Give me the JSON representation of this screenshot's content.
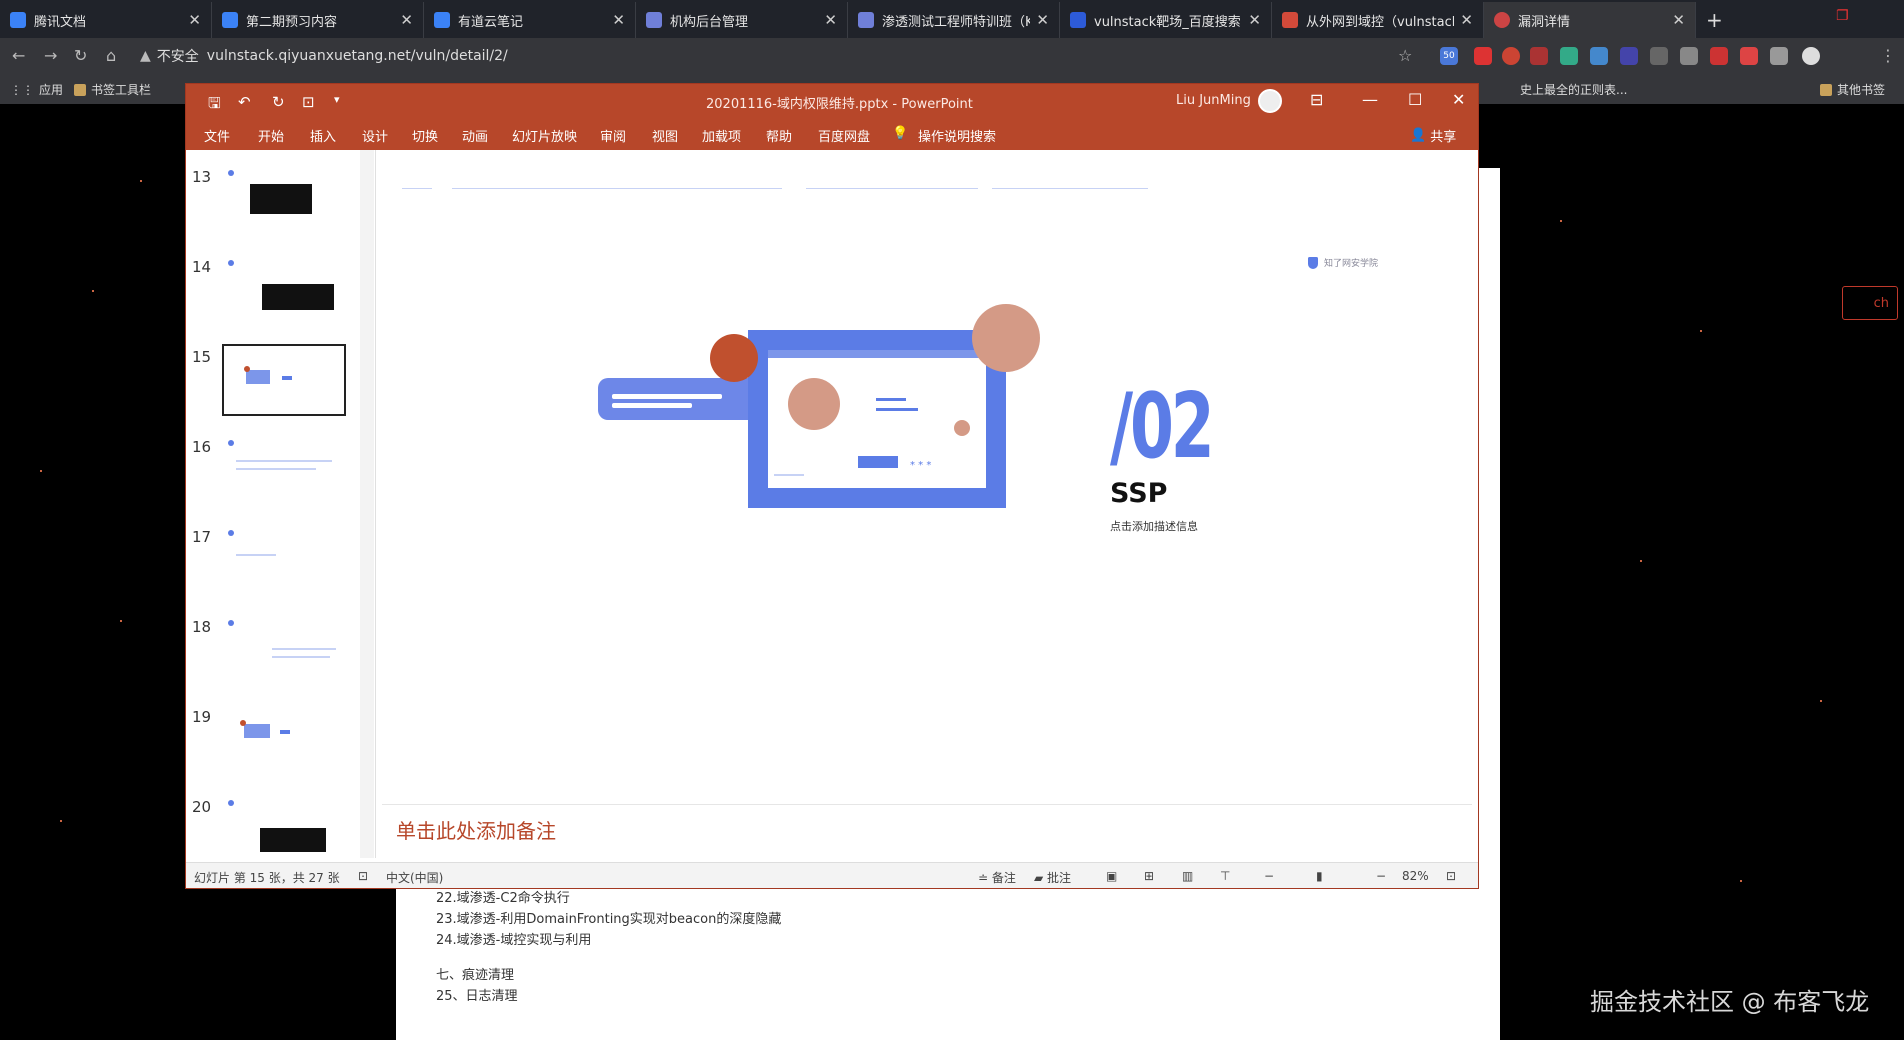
{
  "browser": {
    "tabs": [
      {
        "title": "腾讯文档",
        "favicon": "tencent-docs-icon"
      },
      {
        "title": "第二期预习内容",
        "favicon": "doc-icon"
      },
      {
        "title": "有道云笔记",
        "favicon": "note-icon"
      },
      {
        "title": "机构后台管理",
        "favicon": "shield-icon"
      },
      {
        "title": "渗透测试工程师特训班（Ka",
        "favicon": "shield-icon"
      },
      {
        "title": "vulnstack靶场_百度搜索",
        "favicon": "baidu-icon"
      },
      {
        "title": "从外网到域控（vulnstack靶",
        "favicon": "page-icon"
      },
      {
        "title": "漏洞详情",
        "favicon": "globe-icon",
        "active": true
      }
    ],
    "new_tab": "+",
    "address": {
      "security": "不安全",
      "url": "vulnstack.qiyuanxuetang.net/vuln/detail/2/"
    },
    "bookmarks": [
      {
        "label": "应用"
      },
      {
        "label": "书签工具栏"
      },
      {
        "label": "史上最全的正则表..."
      },
      {
        "label": "其他书签"
      }
    ],
    "extension_badge": "50"
  },
  "page": {
    "list_items": [
      "22.域渗透-C2命令执行",
      "23.域渗透-利用DomainFronting实现对beacon的深度隐藏",
      "24.域渗透-域控实现与利用"
    ],
    "section": "七、痕迹清理",
    "section_items": [
      "25、日志清理"
    ],
    "partial_button": "ch"
  },
  "ppt": {
    "filename": "20201116-域内权限维持.pptx",
    "app_name": "PowerPoint",
    "user": "Liu JunMing",
    "ribbon_tabs": [
      "文件",
      "开始",
      "插入",
      "设计",
      "切换",
      "动画",
      "幻灯片放映",
      "审阅",
      "视图",
      "加载项",
      "帮助",
      "百度网盘",
      "操作说明搜索"
    ],
    "share": "共享",
    "thumbnails": [
      {
        "num": "13",
        "style": "dark-block"
      },
      {
        "num": "14",
        "style": "dark-block"
      },
      {
        "num": "15",
        "style": "illustration",
        "selected": true
      },
      {
        "num": "16",
        "style": "text"
      },
      {
        "num": "17",
        "style": "text"
      },
      {
        "num": "18",
        "style": "text"
      },
      {
        "num": "19",
        "style": "illustration"
      },
      {
        "num": "20",
        "style": "dark-block"
      }
    ],
    "slide": {
      "number": "/02",
      "heading": "SSP",
      "subtitle": "点击添加描述信息",
      "logo_text": "知了网安学院"
    },
    "notes_placeholder": "单击此处添加备注",
    "status": {
      "slide_info": "幻灯片 第 15 张，共 27 张",
      "language": "中文(中国)",
      "notes": "备注",
      "comments": "批注",
      "zoom": "82%"
    }
  },
  "colors": {
    "ppt_red": "#b7472a",
    "accent_blue": "#5b7ce6",
    "accent_orange": "#c0502e",
    "accent_peach": "#d49a86"
  },
  "watermark": "掘金技术社区 @ 布客飞龙"
}
